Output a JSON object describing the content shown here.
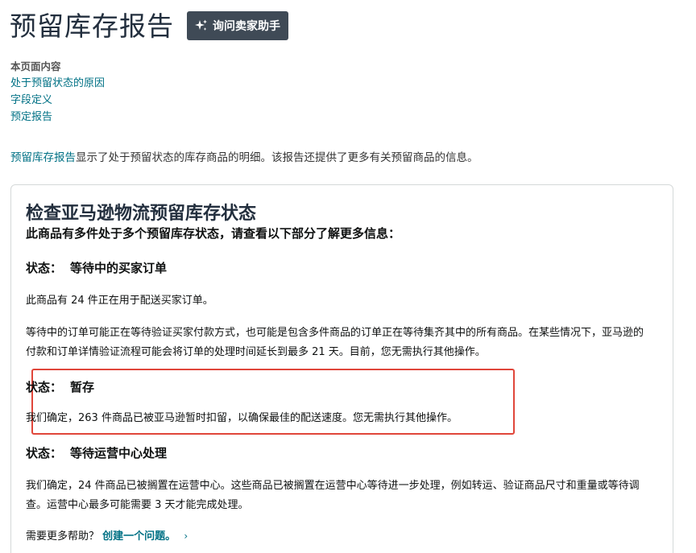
{
  "header": {
    "title": "预留库存报告",
    "ask_button_label": "询问卖家助手"
  },
  "toc": {
    "heading": "本页面内容",
    "links": [
      "处于预留状态的原因",
      "字段定义",
      "预定报告"
    ]
  },
  "intro": {
    "link_text": "预留库存报告",
    "text": "显示了处于预留状态的库存商品的明细。该报告还提供了更多有关预留商品的信息。"
  },
  "card": {
    "title": "检查亚马逊物流预留库存状态",
    "subtitle": "此商品有多件处于多个预留库存状态，请查看以下部分了解更多信息：",
    "sections": [
      {
        "label": "状态：",
        "value": "等待中的买家订单",
        "paragraphs": [
          "此商品有 24 件正在用于配送买家订单。",
          "等待中的订单可能正在等待验证买家付款方式，也可能是包含多件商品的订单正在等待集齐其中的所有商品。在某些情况下，亚马逊的付款和订单详情验证流程可能会将订单的处理时间延长到最多 21 天。目前，您无需执行其他操作。"
        ]
      },
      {
        "label": "状态：",
        "value": "暂存",
        "paragraphs": [
          "我们确定，263 件商品已被亚马逊暂时扣留，以确保最佳的配送速度。您无需执行其他操作。"
        ]
      },
      {
        "label": "状态：",
        "value": "等待运营中心处理",
        "paragraphs": [
          "我们确定，24 件商品已被搁置在运营中心。这些商品已被搁置在运营中心等待进一步处理，例如转运、验证商品尺寸和重量或等待调查。运营中心最多可能需要 3 天才能完成处理。"
        ]
      }
    ],
    "help_text": "需要更多帮助？",
    "help_link": "创建一个问题。",
    "help_chevron": "›"
  },
  "colors": {
    "link": "#007185",
    "button_bg": "#3f4a56",
    "highlight_border": "#e0463a"
  },
  "icons": {
    "ask_button_icon": "sparkle-icon"
  }
}
